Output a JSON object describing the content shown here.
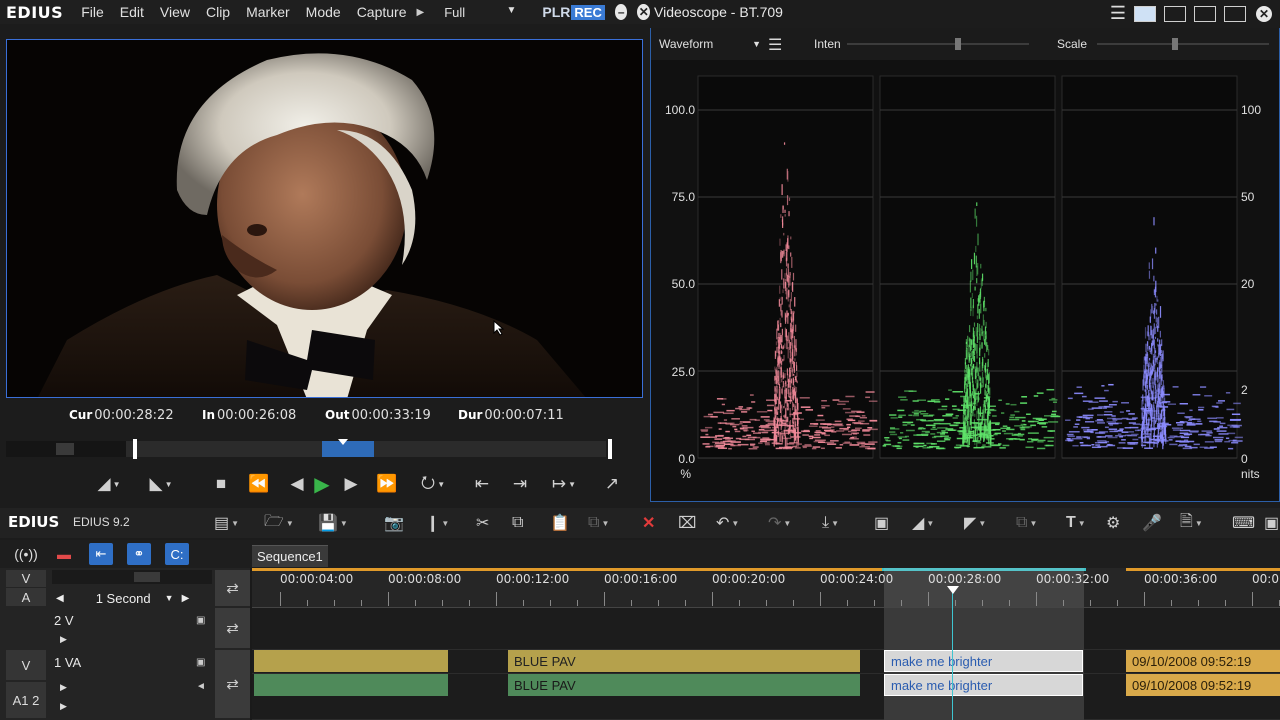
{
  "menubar": {
    "logo": "EDIUS",
    "items": [
      "File",
      "Edit",
      "View",
      "Clip",
      "Marker",
      "Mode",
      "Capture"
    ],
    "mode_select": "Full",
    "plr": "PLR",
    "rec": "REC"
  },
  "player": {
    "cur_label": "Cur",
    "cur": "00:00:28:22",
    "in_label": "In",
    "in": "00:00:26:08",
    "out_label": "Out",
    "out": "00:00:33:19",
    "dur_label": "Dur",
    "dur": "00:00:07:11"
  },
  "scope": {
    "title": "Videoscope - BT.709",
    "mode": "Waveform",
    "inten_label": "Inten",
    "scale_label": "Scale",
    "left_axis": [
      "100.0",
      "75.0",
      "50.0",
      "25.0",
      "0.0"
    ],
    "left_unit": "%",
    "right_axis": [
      "100",
      "50",
      "20",
      "2",
      "0"
    ],
    "right_unit": "nits",
    "channels": [
      {
        "name": "R",
        "color": "#f28a9a"
      },
      {
        "name": "G",
        "color": "#5fe36a"
      },
      {
        "name": "B",
        "color": "#8c8cff"
      }
    ]
  },
  "lower": {
    "logo": "EDIUS",
    "version": "EDIUS 9.2"
  },
  "timeline": {
    "sequence_tab": "Sequence1",
    "zoom_label": "1 Second",
    "v_label": "V",
    "a_label": "A",
    "ruler_labels": [
      "00:00:04:00",
      "00:00:08:00",
      "00:00:12:00",
      "00:00:16:00",
      "00:00:20:00",
      "00:00:24:00",
      "00:00:28:00",
      "00:00:32:00",
      "00:00:36:00",
      "00:0"
    ],
    "tracks": {
      "t2v": "2 V",
      "t1va": "1 VA",
      "v_patch": "V",
      "a_patch": "A1 2"
    },
    "clips": {
      "blue_pav_video": "BLUE PAV",
      "blue_pav_audio": "BLUE PAV",
      "brighter_video": "make me brighter",
      "brighter_audio": "make me brighter",
      "date_video": "09/10/2008 09:52:19",
      "date_audio": "09/10/2008 09:52:19"
    }
  },
  "colors": {
    "accent": "#3a6fd8",
    "play": "#39b54a",
    "playhead": "#3fc5d0",
    "in_out_bar": "#e09a2a"
  }
}
